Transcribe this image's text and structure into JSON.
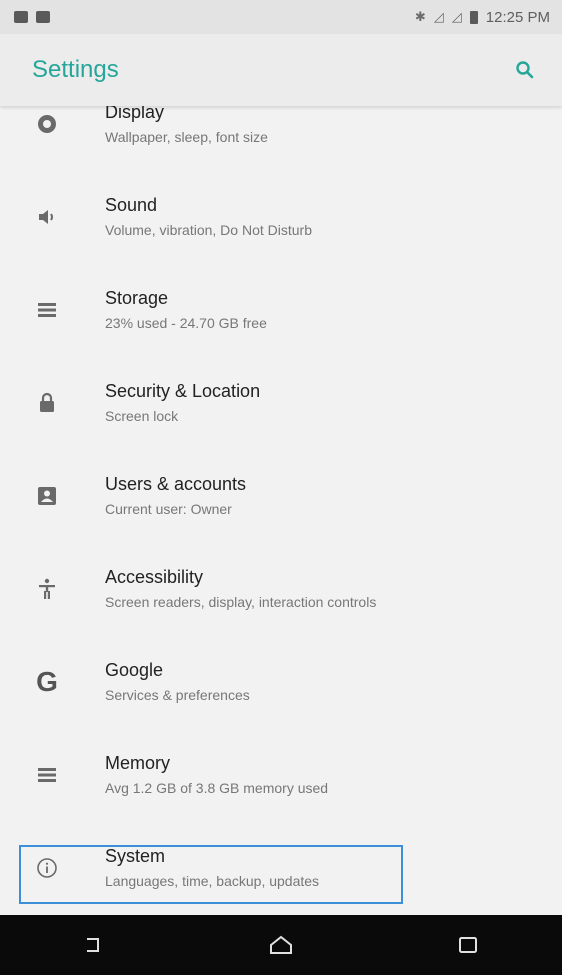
{
  "status_bar": {
    "time": "12:25 PM",
    "icons": [
      "notification-icon",
      "notification-icon",
      "bluetooth-icon",
      "signal-icon",
      "signal-icon",
      "battery-icon"
    ]
  },
  "app_bar": {
    "title": "Settings",
    "accent_color": "#26a69a",
    "action_icon": "search-icon"
  },
  "settings": [
    {
      "title": "Display",
      "subtitle": "Wallpaper, sleep, font size",
      "icon": "display-icon"
    },
    {
      "title": "Sound",
      "subtitle": "Volume, vibration, Do Not Disturb",
      "icon": "volume-icon"
    },
    {
      "title": "Storage",
      "subtitle": "23% used - 24.70 GB free",
      "icon": "storage-icon"
    },
    {
      "title": "Security & Location",
      "subtitle": "Screen lock",
      "icon": "lock-icon"
    },
    {
      "title": "Users & accounts",
      "subtitle": "Current user: Owner",
      "icon": "account-box-icon"
    },
    {
      "title": "Accessibility",
      "subtitle": "Screen readers, display, interaction controls",
      "icon": "accessibility-icon"
    },
    {
      "title": "Google",
      "subtitle": "Services & preferences",
      "icon": "google-icon"
    },
    {
      "title": "Memory",
      "subtitle": "Avg 1.2 GB of 3.8 GB memory used",
      "icon": "memory-icon"
    },
    {
      "title": "System",
      "subtitle": "Languages, time, backup, updates",
      "icon": "info-icon"
    }
  ],
  "highlight_color": "#3d8fd8",
  "nav_bar": {
    "buttons": [
      "back-icon",
      "home-icon",
      "recents-icon"
    ]
  }
}
